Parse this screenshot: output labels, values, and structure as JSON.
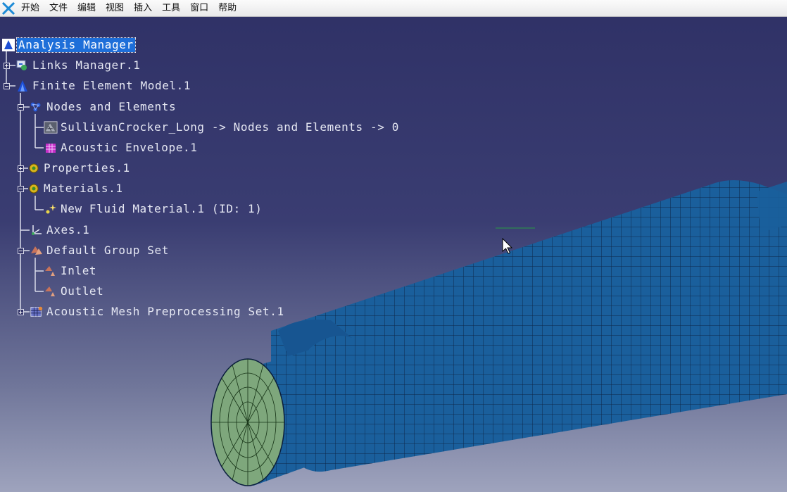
{
  "menu": {
    "items": [
      "开始",
      "文件",
      "编辑",
      "视图",
      "插入",
      "工具",
      "窗口",
      "帮助"
    ]
  },
  "tree": {
    "root": "Analysis Manager",
    "links_manager": "Links Manager.1",
    "fem": "Finite Element Model.1",
    "nodes_elements": "Nodes and Elements",
    "mesh_part": "SullivanCrocker_Long -> Nodes and Elements -> 0",
    "acoustic_envelope": "Acoustic Envelope.1",
    "properties": "Properties.1",
    "materials": "Materials.1",
    "fluid_material": "New Fluid Material.1 (ID: 1)",
    "axes": "Axes.1",
    "group_set": "Default Group Set",
    "inlet": "Inlet",
    "outlet": "Outlet",
    "mesh_preprocessing": "Acoustic Mesh Preprocessing Set.1"
  },
  "colors": {
    "mesh_blue": "#1a5f9c",
    "end_face": "#7ea77c",
    "selection": "#1e6fd9"
  }
}
